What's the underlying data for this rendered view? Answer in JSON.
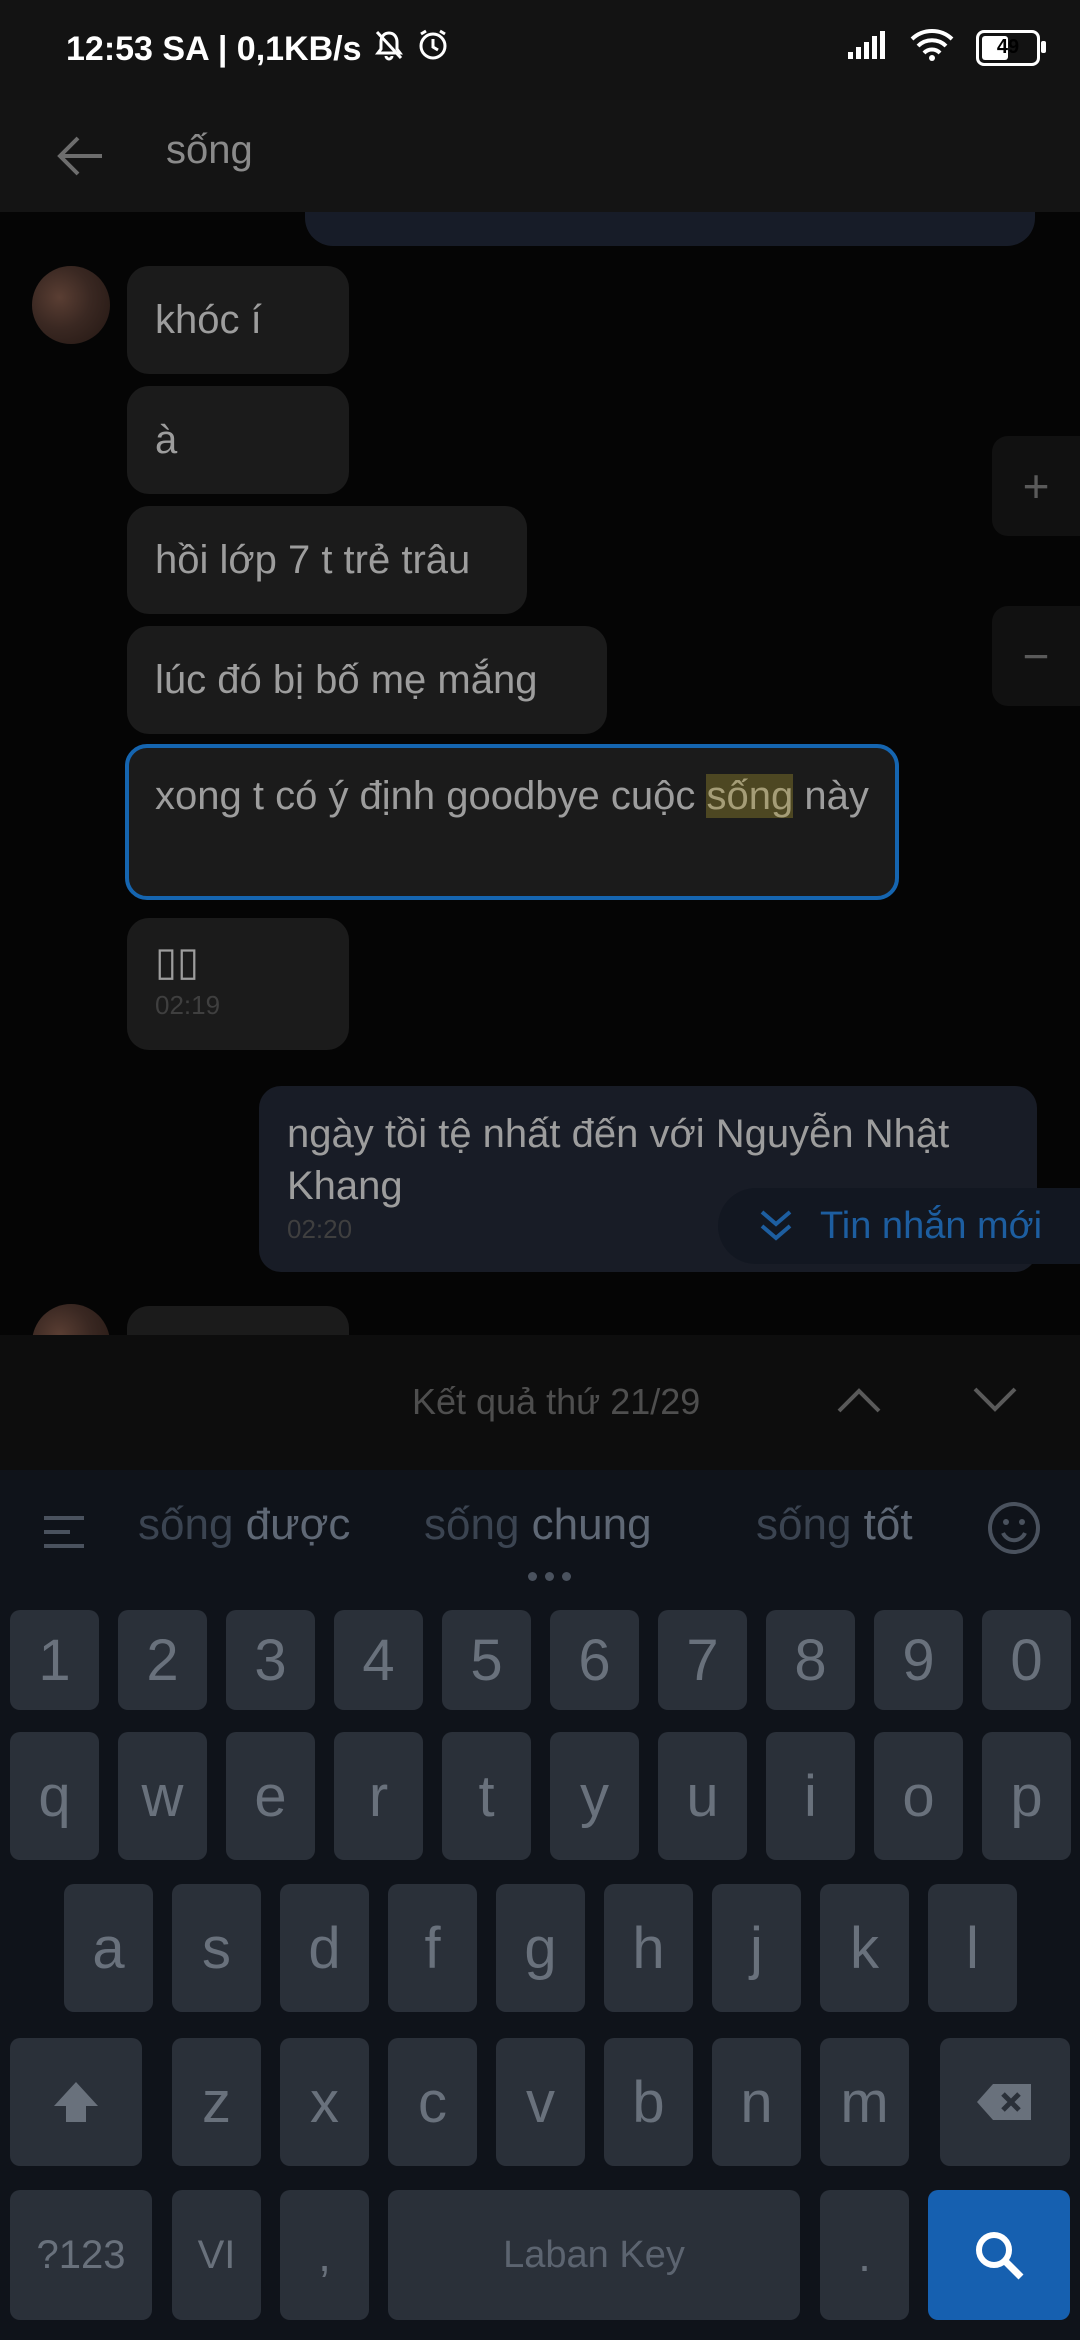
{
  "status_bar": {
    "time_net": "12:53 SA | 0,1KB/s",
    "battery": "49"
  },
  "header": {
    "search_query": "sống"
  },
  "messages": [
    {
      "text": "khóc í"
    },
    {
      "text": "à"
    },
    {
      "text": "hồi lớp 7 t trẻ trâu"
    },
    {
      "text": "lúc đó bị bố mẹ mắng"
    },
    {
      "text_before": "xong t có ý định goodbye cuộc ",
      "highlight": "sống",
      "text_after": " này"
    },
    {
      "text": "▯▯",
      "time": "02:19"
    },
    {
      "text": "ngày tồi tệ nhất đến với Nguyễn Nhật Khang",
      "time": "02:20"
    }
  ],
  "zoom": {
    "plus": "+",
    "minus": "−"
  },
  "new_message_label": "Tin nhắn mới",
  "result_bar": {
    "text": "Kết quả thứ 21/29"
  },
  "keyboard": {
    "suggestions": [
      {
        "prefix": "sống",
        "word": "được"
      },
      {
        "prefix": "sống",
        "word": "chung"
      },
      {
        "prefix": "sống",
        "word": "tốt"
      }
    ],
    "number_row": [
      "1",
      "2",
      "3",
      "4",
      "5",
      "6",
      "7",
      "8",
      "9",
      "0"
    ],
    "row1": [
      "q",
      "w",
      "e",
      "r",
      "t",
      "y",
      "u",
      "i",
      "o",
      "p"
    ],
    "row2": [
      "a",
      "s",
      "d",
      "f",
      "g",
      "h",
      "j",
      "k",
      "l"
    ],
    "row3": [
      "z",
      "x",
      "c",
      "v",
      "b",
      "n",
      "m"
    ],
    "bottom": {
      "symbols": "?123",
      "lang": "VI",
      "comma": ",",
      "space": "Laban Key",
      "period": "."
    }
  },
  "colors": {
    "accent": "#1565b0",
    "highlight": "#4d4722",
    "search_key": "#1660b0"
  }
}
